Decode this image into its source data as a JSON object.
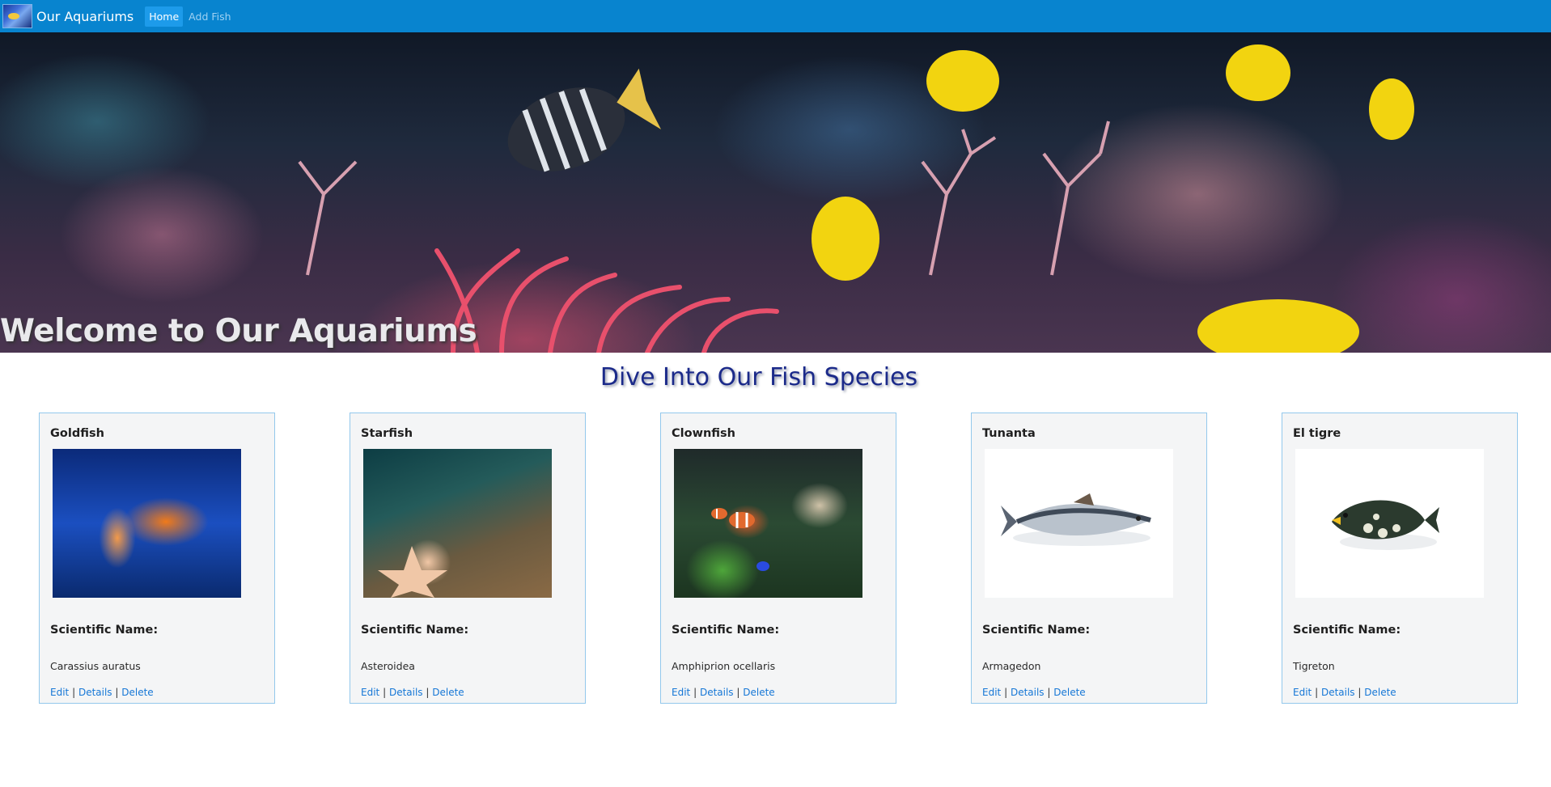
{
  "nav": {
    "brand": "Our Aquariums",
    "links": [
      {
        "label": "Home"
      },
      {
        "label": "Add Fish"
      }
    ]
  },
  "hero": {
    "title": "Welcome to Our Aquariums"
  },
  "section": {
    "title": "Dive Into Our Fish Species"
  },
  "labels": {
    "scientific_name": "Scientific Name:"
  },
  "actions": {
    "edit": "Edit",
    "details": "Details",
    "delete": "Delete",
    "separator": "|"
  },
  "fish": [
    {
      "name": "Goldfish",
      "scientific": "Carassius auratus",
      "image": "goldfish-image"
    },
    {
      "name": "Starfish",
      "scientific": "Asteroidea",
      "image": "starfish-image"
    },
    {
      "name": "Clownfish",
      "scientific": "Amphiprion ocellaris",
      "image": "clownfish-image"
    },
    {
      "name": "Tunanta",
      "scientific": "Armagedon",
      "image": "tuna-image"
    },
    {
      "name": "El tigre",
      "scientific": "Tigreton",
      "image": "triggerfish-image"
    }
  ]
}
